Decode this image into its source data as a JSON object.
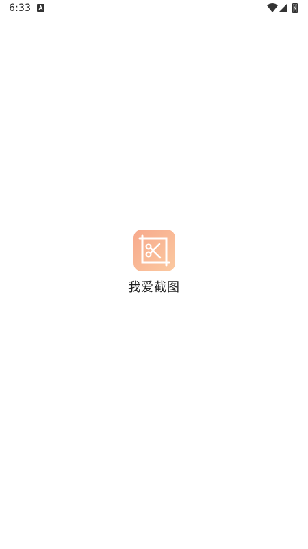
{
  "status_bar": {
    "time": "6:33",
    "notification_icon": "a-notification-icon",
    "wifi_icon": "wifi-icon",
    "signal_icon": "cell-signal-icon",
    "battery_icon": "battery-charging-icon",
    "text_color": "#222222"
  },
  "splash": {
    "app_name": "我爱截图",
    "logo_icon": "screenshot-crop-scissors-icon",
    "logo_gradient": [
      "#f7a98c",
      "#fbc9a0"
    ]
  }
}
